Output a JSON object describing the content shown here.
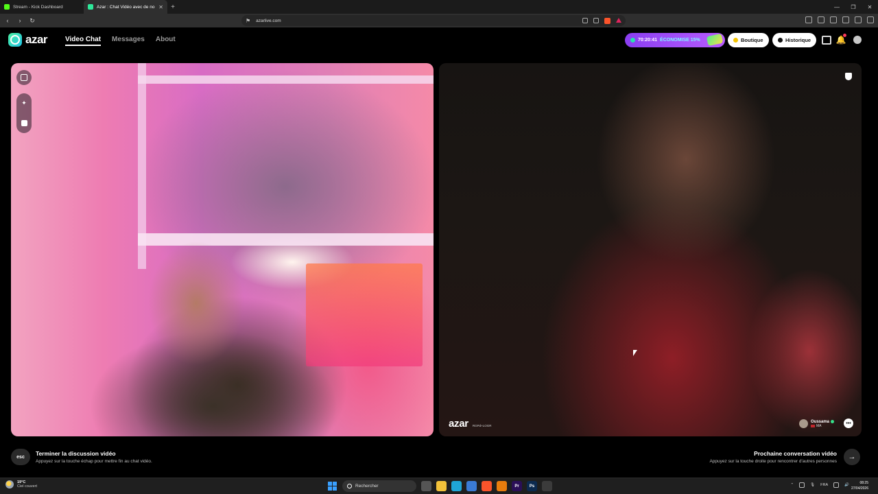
{
  "browser": {
    "tabs": [
      {
        "label": "Stream - Kick Dashboard",
        "favicon_color": "#53fc18",
        "active": false
      },
      {
        "label": "Azar : Chat Vidéo avec de no",
        "favicon_color": "#2ee89a",
        "active": true
      }
    ],
    "url": "azarlive.com"
  },
  "header": {
    "logo_text": "azar",
    "nav": [
      "Video Chat",
      "Messages",
      "About"
    ],
    "promo": {
      "timer": "70:20:41",
      "discount": "ÉCONOMISE 15%"
    },
    "boutique_label": "Boutique",
    "historique_label": "Historique"
  },
  "remote_video": {
    "watermark": "azar",
    "watermark_sub": "RGPd+LOGR",
    "peer_name": "Oussama",
    "peer_country": "MA"
  },
  "controls": {
    "esc_key": "esc",
    "end_title": "Terminer la discussion vidéo",
    "end_hint": "Appuyez sur la touche échap pour mettre fin au chat vidéo.",
    "next_title": "Prochaine conversation vidéo",
    "next_hint": "Appuyez sur la touche droite pour rencontrer d'autres personnes"
  },
  "taskbar": {
    "weather_temp": "19°C",
    "weather_desc": "Ciel couvert",
    "search_placeholder": "Rechercher",
    "language": "FRA",
    "time": "08:25",
    "date": "27/04/2026"
  },
  "colors": {
    "accent_purple": "#8a3ef0",
    "brand_green": "#4bf0a0"
  }
}
